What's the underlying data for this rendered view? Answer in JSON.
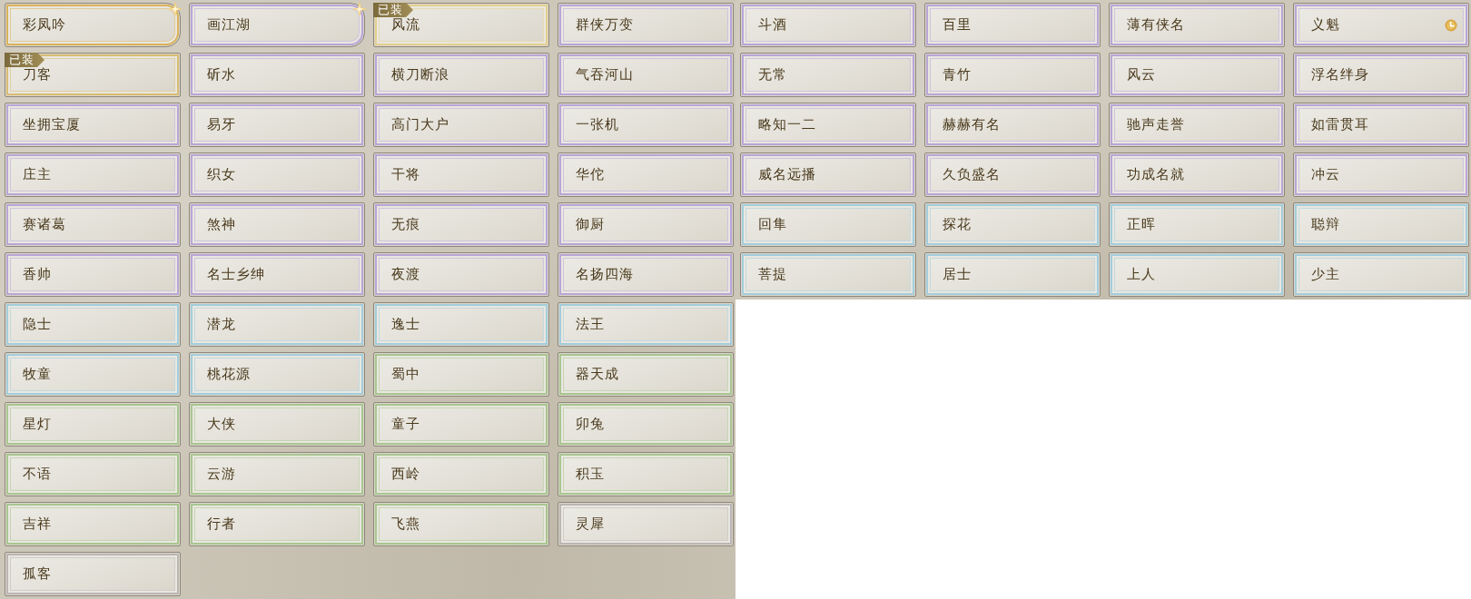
{
  "panels": [
    {
      "titles": [
        {
          "label": "彩凤吟",
          "color": "#d9b25c",
          "sparkle": true,
          "timed": false
        },
        {
          "label": "画江湖",
          "color": "#b9a5d8",
          "sparkle": true,
          "timed": false
        },
        {
          "label": "风流",
          "color": "#e4cf8e",
          "sparkle": false,
          "timed": false,
          "badge": "已装"
        },
        {
          "label": "群侠万变",
          "color": "#b9a5d8",
          "sparkle": false,
          "timed": false
        },
        {
          "label": "刀客",
          "color": "#d8bc72",
          "sparkle": false,
          "timed": false,
          "badge": "已装"
        },
        {
          "label": "斫水",
          "color": "#b9a5d8",
          "sparkle": false,
          "timed": false
        },
        {
          "label": "横刀断浪",
          "color": "#b9a5d8",
          "sparkle": false,
          "timed": false
        },
        {
          "label": "气吞河山",
          "color": "#b9a5d8",
          "sparkle": false,
          "timed": false
        },
        {
          "label": "坐拥宝厦",
          "color": "#b9a5d8",
          "sparkle": false,
          "timed": false
        },
        {
          "label": "易牙",
          "color": "#b9a5d8",
          "sparkle": false,
          "timed": false
        },
        {
          "label": "高门大户",
          "color": "#b9a5d8",
          "sparkle": false,
          "timed": false
        },
        {
          "label": "一张机",
          "color": "#b9a5d8",
          "sparkle": false,
          "timed": false
        },
        {
          "label": "庄主",
          "color": "#b9a5d8",
          "sparkle": false,
          "timed": false
        },
        {
          "label": "织女",
          "color": "#b9a5d8",
          "sparkle": false,
          "timed": false
        },
        {
          "label": "干将",
          "color": "#b9a5d8",
          "sparkle": false,
          "timed": false
        },
        {
          "label": "华佗",
          "color": "#b9a5d8",
          "sparkle": false,
          "timed": false
        },
        {
          "label": "赛诸葛",
          "color": "#b9a5d8",
          "sparkle": false,
          "timed": false
        },
        {
          "label": "煞神",
          "color": "#b9a5d8",
          "sparkle": false,
          "timed": false
        },
        {
          "label": "无痕",
          "color": "#b9a5d8",
          "sparkle": false,
          "timed": false
        },
        {
          "label": "御厨",
          "color": "#b9a5d8",
          "sparkle": false,
          "timed": false
        },
        {
          "label": "香帅",
          "color": "#b9a5d8",
          "sparkle": false,
          "timed": false
        },
        {
          "label": "名士乡绅",
          "color": "#b9a5d8",
          "sparkle": false,
          "timed": false
        },
        {
          "label": "夜渡",
          "color": "#b9a5d8",
          "sparkle": false,
          "timed": false
        },
        {
          "label": "名扬四海",
          "color": "#b9a5d8",
          "sparkle": false,
          "timed": false
        },
        {
          "label": "隐士",
          "color": "#a3cddd",
          "sparkle": false,
          "timed": false
        },
        {
          "label": "潜龙",
          "color": "#a3cddd",
          "sparkle": false,
          "timed": false
        },
        {
          "label": "逸士",
          "color": "#a3cddd",
          "sparkle": false,
          "timed": false
        },
        {
          "label": "法王",
          "color": "#a3cddd",
          "sparkle": false,
          "timed": false
        },
        {
          "label": "牧童",
          "color": "#a3cddd",
          "sparkle": false,
          "timed": false
        },
        {
          "label": "桃花源",
          "color": "#a3cddd",
          "sparkle": false,
          "timed": false
        },
        {
          "label": "蜀中",
          "color": "#a8c690",
          "sparkle": false,
          "timed": false
        },
        {
          "label": "器天成",
          "color": "#a8c690",
          "sparkle": false,
          "timed": false
        },
        {
          "label": "星灯",
          "color": "#a8c690",
          "sparkle": false,
          "timed": false
        },
        {
          "label": "大侠",
          "color": "#a8c690",
          "sparkle": false,
          "timed": false
        },
        {
          "label": "童子",
          "color": "#a8c690",
          "sparkle": false,
          "timed": false
        },
        {
          "label": "卯兔",
          "color": "#a8c690",
          "sparkle": false,
          "timed": false
        },
        {
          "label": "不语",
          "color": "#a8c690",
          "sparkle": false,
          "timed": false
        },
        {
          "label": "云游",
          "color": "#a8c690",
          "sparkle": false,
          "timed": false
        },
        {
          "label": "西岭",
          "color": "#a8c690",
          "sparkle": false,
          "timed": false
        },
        {
          "label": "积玉",
          "color": "#a8c690",
          "sparkle": false,
          "timed": false
        },
        {
          "label": "吉祥",
          "color": "#a8c690",
          "sparkle": false,
          "timed": false
        },
        {
          "label": "行者",
          "color": "#a8c690",
          "sparkle": false,
          "timed": false
        },
        {
          "label": "飞燕",
          "color": "#a8c690",
          "sparkle": false,
          "timed": false
        },
        {
          "label": "灵犀",
          "color": "#bbb5b4",
          "sparkle": false,
          "timed": false
        },
        {
          "label": "孤客",
          "color": "#bbb5b4",
          "sparkle": false,
          "timed": false
        }
      ]
    },
    {
      "titles": [
        {
          "label": "斗酒",
          "color": "#b9a5d8",
          "sparkle": false,
          "timed": false
        },
        {
          "label": "百里",
          "color": "#b9a5d8",
          "sparkle": false,
          "timed": false
        },
        {
          "label": "薄有侠名",
          "color": "#b9a5d8",
          "sparkle": false,
          "timed": false
        },
        {
          "label": "义魁",
          "color": "#b9a5d8",
          "sparkle": false,
          "timed": true
        },
        {
          "label": "无常",
          "color": "#b9a5d8",
          "sparkle": false,
          "timed": false
        },
        {
          "label": "青竹",
          "color": "#b9a5d8",
          "sparkle": false,
          "timed": false
        },
        {
          "label": "风云",
          "color": "#b9a5d8",
          "sparkle": false,
          "timed": false
        },
        {
          "label": "浮名绊身",
          "color": "#b9a5d8",
          "sparkle": false,
          "timed": false
        },
        {
          "label": "略知一二",
          "color": "#b9a5d8",
          "sparkle": false,
          "timed": false
        },
        {
          "label": "赫赫有名",
          "color": "#b9a5d8",
          "sparkle": false,
          "timed": false
        },
        {
          "label": "驰声走誉",
          "color": "#b9a5d8",
          "sparkle": false,
          "timed": false
        },
        {
          "label": "如雷贯耳",
          "color": "#b9a5d8",
          "sparkle": false,
          "timed": false
        },
        {
          "label": "威名远播",
          "color": "#b9a5d8",
          "sparkle": false,
          "timed": false
        },
        {
          "label": "久负盛名",
          "color": "#b9a5d8",
          "sparkle": false,
          "timed": false
        },
        {
          "label": "功成名就",
          "color": "#b9a5d8",
          "sparkle": false,
          "timed": false
        },
        {
          "label": "冲云",
          "color": "#b9a5d8",
          "sparkle": false,
          "timed": false
        },
        {
          "label": "回隼",
          "color": "#a3cddd",
          "sparkle": false,
          "timed": false
        },
        {
          "label": "探花",
          "color": "#a3cddd",
          "sparkle": false,
          "timed": false
        },
        {
          "label": "正晖",
          "color": "#a3cddd",
          "sparkle": false,
          "timed": false
        },
        {
          "label": "聪辩",
          "color": "#a3cddd",
          "sparkle": false,
          "timed": false
        },
        {
          "label": "菩提",
          "color": "#a3cddd",
          "sparkle": false,
          "timed": false
        },
        {
          "label": "居士",
          "color": "#a3cddd",
          "sparkle": false,
          "timed": false
        },
        {
          "label": "上人",
          "color": "#a3cddd",
          "sparkle": false,
          "timed": false
        },
        {
          "label": "少主",
          "color": "#a3cddd",
          "sparkle": false,
          "timed": false
        }
      ]
    }
  ]
}
